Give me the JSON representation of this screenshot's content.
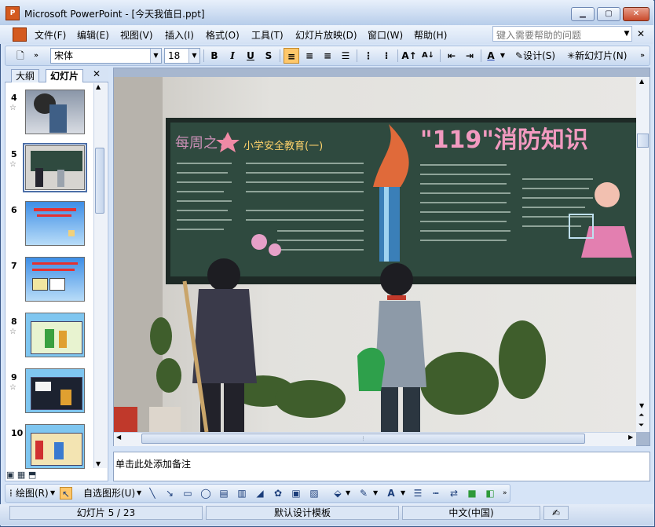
{
  "window": {
    "title": "Microsoft PowerPoint - [今天我值日.ppt]",
    "icon": "powerpoint-icon"
  },
  "menu": {
    "items": [
      "文件(F)",
      "编辑(E)",
      "视图(V)",
      "插入(I)",
      "格式(O)",
      "工具(T)",
      "幻灯片放映(D)",
      "窗口(W)",
      "帮助(H)"
    ],
    "help_placeholder": "键入需要帮助的问题",
    "close": "✕"
  },
  "toolbar": {
    "font_name": "宋体",
    "font_size": "18",
    "bold": "B",
    "italic": "I",
    "underline": "U",
    "shadow": "S",
    "font_color": "A",
    "design_label": "设计(S)",
    "new_slide_label": "新幻灯片(N)"
  },
  "left_pane": {
    "tab_outline": "大纲",
    "tab_slides": "幻灯片",
    "close": "✕",
    "slides": [
      {
        "number": "4",
        "star": "☆"
      },
      {
        "number": "5",
        "star": "☆",
        "selected": true
      },
      {
        "number": "6"
      },
      {
        "number": "7"
      },
      {
        "number": "8",
        "star": "☆"
      },
      {
        "number": "9",
        "star": "☆"
      },
      {
        "number": "10"
      }
    ]
  },
  "slide": {
    "blackboard_title": "\"119\"消防知识",
    "board_left_heading": "每周之★",
    "board_sub_heading": "小学安全教育(一)"
  },
  "notes": {
    "placeholder": "单击此处添加备注"
  },
  "drawing": {
    "draw_label": "绘图(R)",
    "autoshape_label": "自选图形(U)"
  },
  "status": {
    "slide": "幻灯片 5 / 23",
    "template": "默认设计模板",
    "language": "中文(中国)"
  },
  "colors": {
    "chalkboard": "#2f4a3f",
    "wall": "#e6e4e0",
    "accent": "#ffc76a"
  }
}
